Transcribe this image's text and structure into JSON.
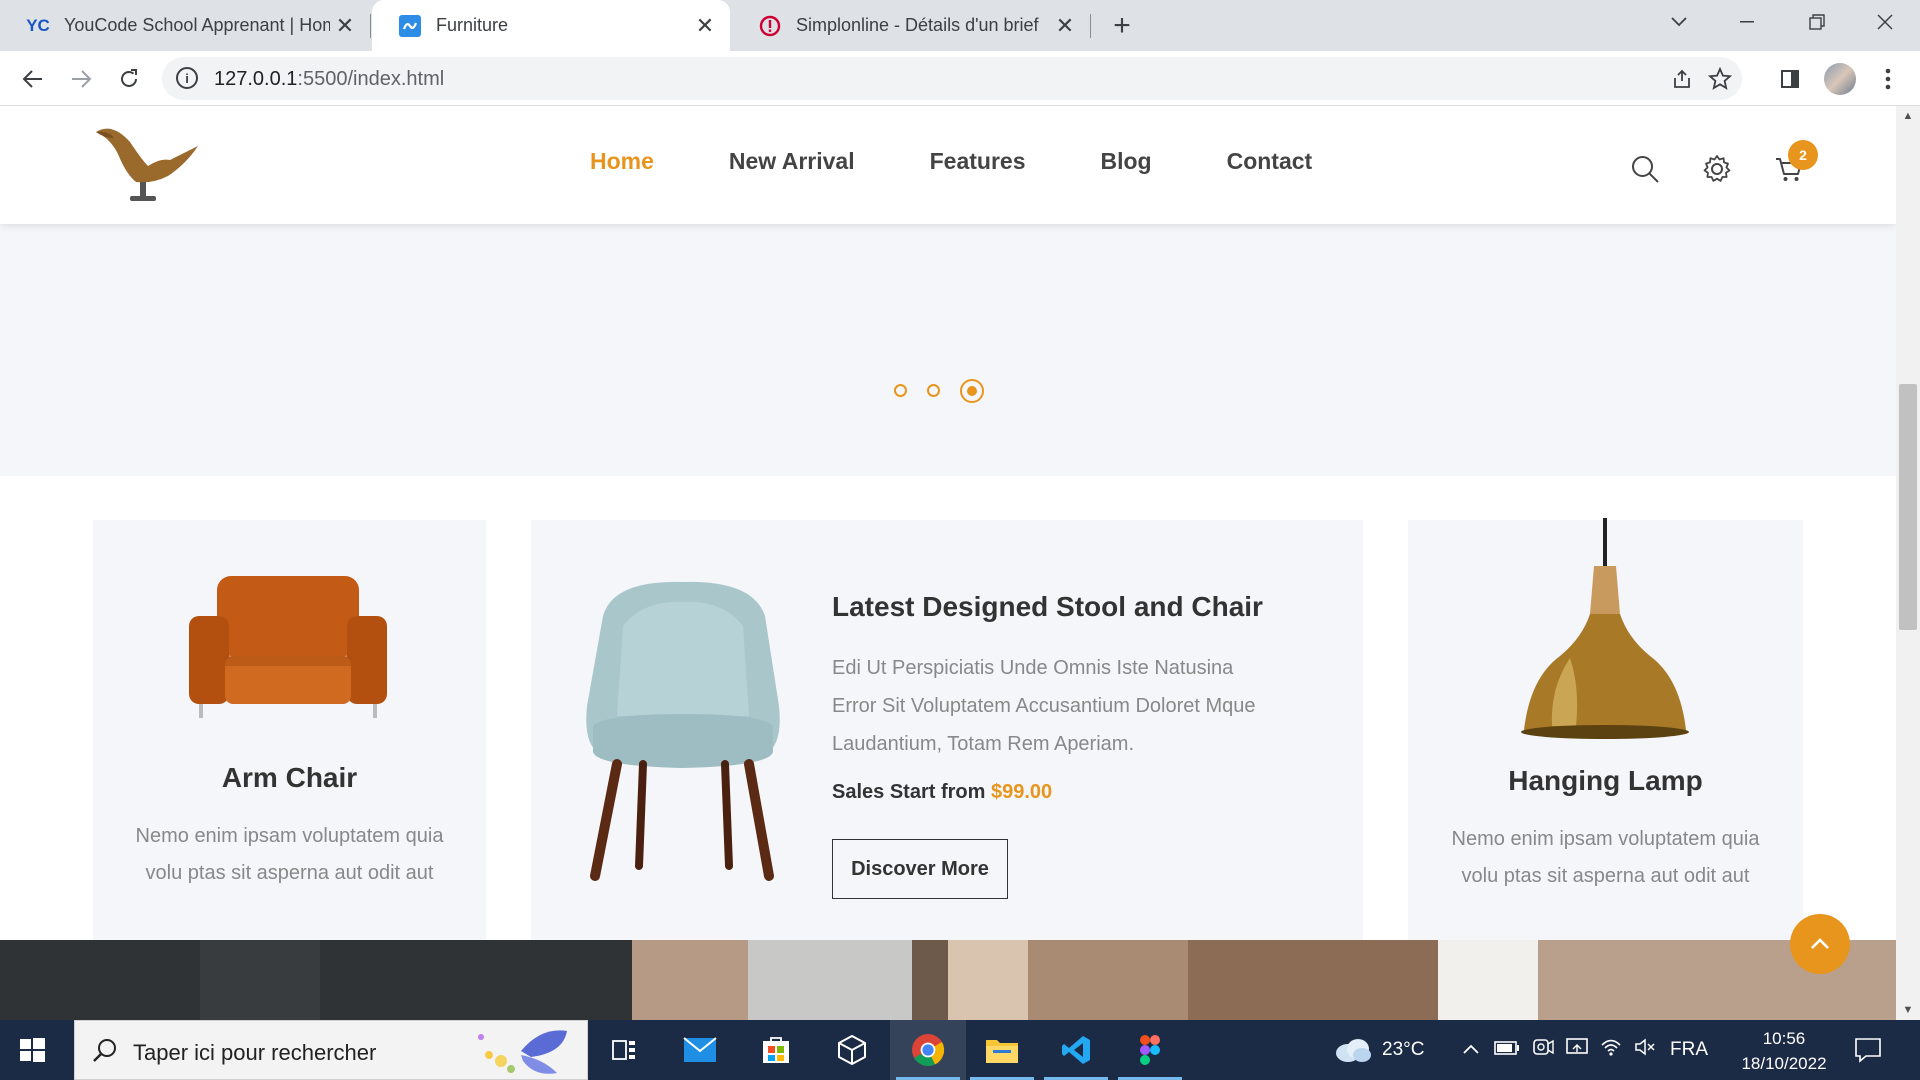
{
  "browser": {
    "tabs": [
      {
        "title": "YouCode School Apprenant | Home",
        "favicon": "YC"
      },
      {
        "title": "Furniture",
        "favicon": "ru"
      },
      {
        "title": "Simplonline - Détails d'un brief",
        "favicon": "simplon"
      }
    ],
    "url_host": "127.0.0.1",
    "url_path": ":5500/index.html"
  },
  "site": {
    "nav": [
      "Home",
      "New Arrival",
      "Features",
      "Blog",
      "Contact"
    ],
    "cart_count": "2",
    "slider_active_index": 2,
    "slider_dots": 3,
    "accent": "#e8951e"
  },
  "products": {
    "left": {
      "name": "Arm Chair",
      "desc_line1": "Nemo enim ipsam voluptatem quia",
      "desc_line2": "volu ptas sit asperna aut odit aut"
    },
    "featured": {
      "title": "Latest Designed Stool and Chair",
      "desc_line1": "Edi Ut Perspiciatis Unde Omnis Iste Natusina",
      "desc_line2": "Error Sit Voluptatem Accusantium Doloret Mque",
      "desc_line3": "Laudantium, Totam Rem Aperiam.",
      "price_label": "Sales Start from",
      "price": "$99.00",
      "cta": "Discover More"
    },
    "right": {
      "name": "Hanging Lamp",
      "desc_line1": "Nemo enim ipsam voluptatem quia",
      "desc_line2": "volu ptas sit asperna aut odit aut"
    }
  },
  "taskbar": {
    "search_placeholder": "Taper ici pour rechercher",
    "weather": "23°C",
    "language": "FRA",
    "time": "10:56",
    "date": "18/10/2022"
  }
}
